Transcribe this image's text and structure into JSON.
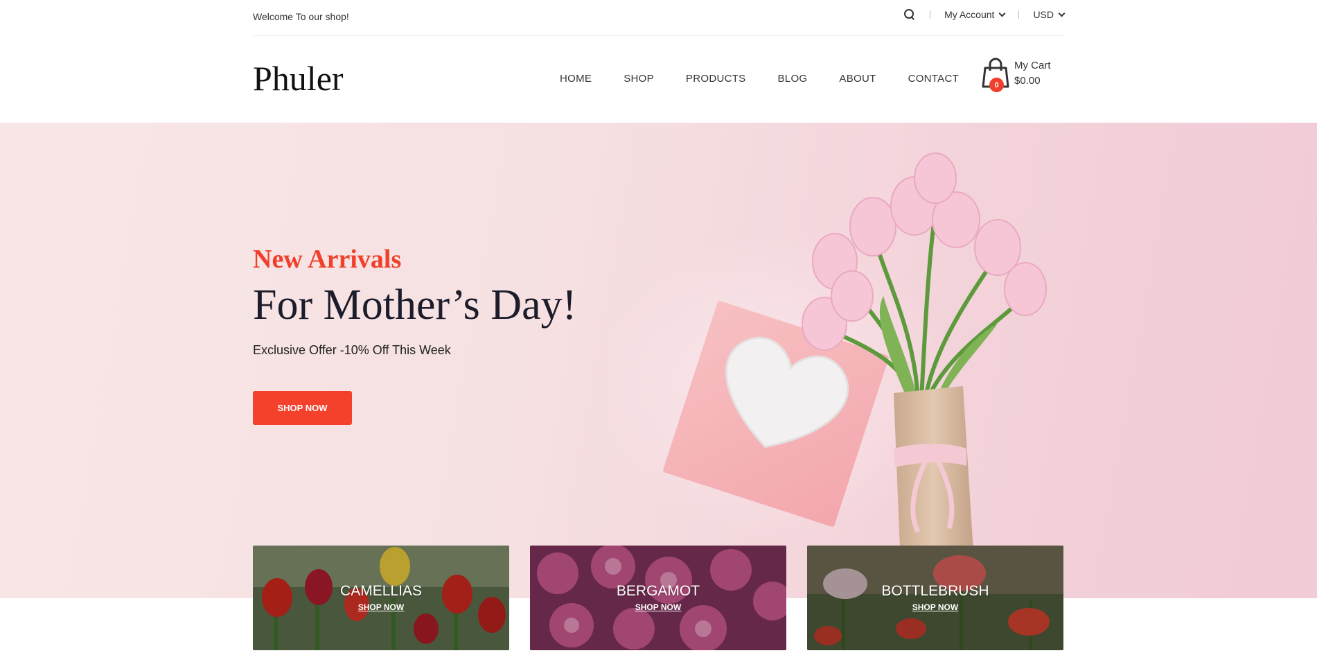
{
  "topbar": {
    "welcome": "Welcome To our shop!",
    "account_label": "My Account",
    "currency_label": "USD"
  },
  "header": {
    "logo": "Phuler",
    "nav": [
      "HOME",
      "SHOP",
      "PRODUCTS",
      "BLOG",
      "ABOUT",
      "CONTACT"
    ],
    "cart": {
      "count": "0",
      "title": "My Cart",
      "total": "$0.00"
    }
  },
  "hero": {
    "subtitle": "New Arrivals",
    "title": "For Mother’s Day!",
    "offer": "Exclusive Offer -10% Off This Week",
    "button": "SHOP NOW"
  },
  "banners": [
    {
      "title": "CAMELLIAS",
      "link": "SHOP NOW"
    },
    {
      "title": "BERGAMOT",
      "link": "SHOP NOW"
    },
    {
      "title": "BOTTLEBRUSH",
      "link": "SHOP NOW"
    }
  ],
  "colors": {
    "accent": "#f0402c",
    "hero_bg": "#f6e1e2",
    "text_dark": "#1c1c2a"
  }
}
